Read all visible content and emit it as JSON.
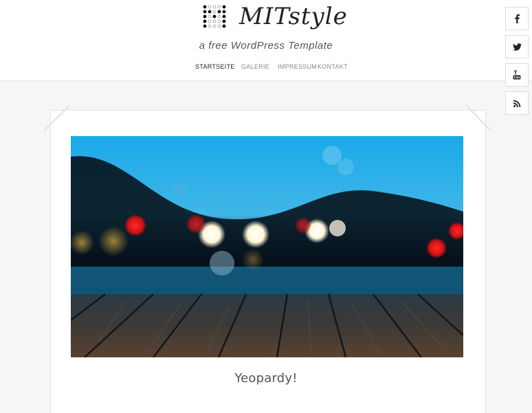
{
  "site": {
    "logo_text": "MITstyle",
    "tagline": "a free WordPress Template"
  },
  "nav": {
    "items": [
      {
        "label": "STARTSEITE",
        "active": true
      },
      {
        "label": "GALERIE",
        "active": false
      },
      {
        "label": "IMPRESSUM",
        "active": false
      },
      {
        "label": "KONTAKT",
        "active": false
      }
    ]
  },
  "social": {
    "icons": [
      "facebook-icon",
      "twitter-icon",
      "youtube-icon",
      "rss-icon"
    ]
  },
  "post": {
    "title": "Yeopardy!"
  },
  "colors": {
    "background": "#f6f6f6",
    "text_dark": "#222222",
    "nav_inactive": "#888888"
  }
}
